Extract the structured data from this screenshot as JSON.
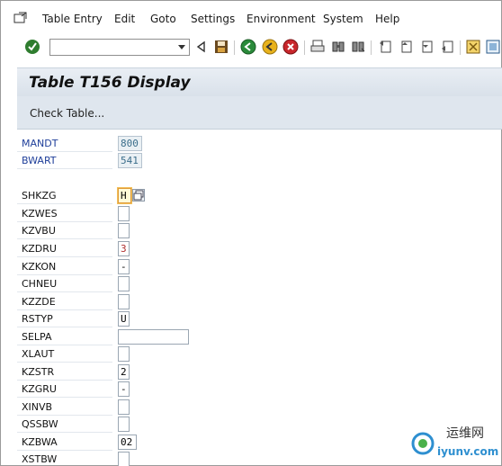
{
  "menubar": {
    "items": [
      "Table Entry",
      "Edit",
      "Goto",
      "Settings",
      "Environment",
      "System",
      "Help"
    ]
  },
  "toolbar": {
    "command_field_value": ""
  },
  "titlebar": {
    "title": "Table T156 Display"
  },
  "app_toolbar": {
    "check_table_label": "Check Table..."
  },
  "fields": [
    {
      "name": "MANDT",
      "value": "800"
    },
    {
      "name": "BWART",
      "value": "541"
    },
    {
      "name": "SHKZG",
      "value": "H"
    },
    {
      "name": "KZWES",
      "value": ""
    },
    {
      "name": "KZVBU",
      "value": ""
    },
    {
      "name": "KZDRU",
      "value": "3"
    },
    {
      "name": "KZKON",
      "value": "-"
    },
    {
      "name": "CHNEU",
      "value": ""
    },
    {
      "name": "KZZDE",
      "value": ""
    },
    {
      "name": "RSTYP",
      "value": "U"
    },
    {
      "name": "SELPA",
      "value": ""
    },
    {
      "name": "XLAUT",
      "value": ""
    },
    {
      "name": "KZSTR",
      "value": "2"
    },
    {
      "name": "KZGRU",
      "value": "-"
    },
    {
      "name": "XINVB",
      "value": ""
    },
    {
      "name": "QSSBW",
      "value": ""
    },
    {
      "name": "KZBWA",
      "value": "02"
    },
    {
      "name": "XSTBW",
      "value": ""
    }
  ],
  "watermark": {
    "text": "运维网",
    "url_text": "iyunv.com"
  },
  "colors": {
    "title_bg": "#e3e9f0",
    "key_label": "#1f3f9a",
    "key_value_bg": "#eaf0f4",
    "highlight_border": "#e09a3a"
  }
}
